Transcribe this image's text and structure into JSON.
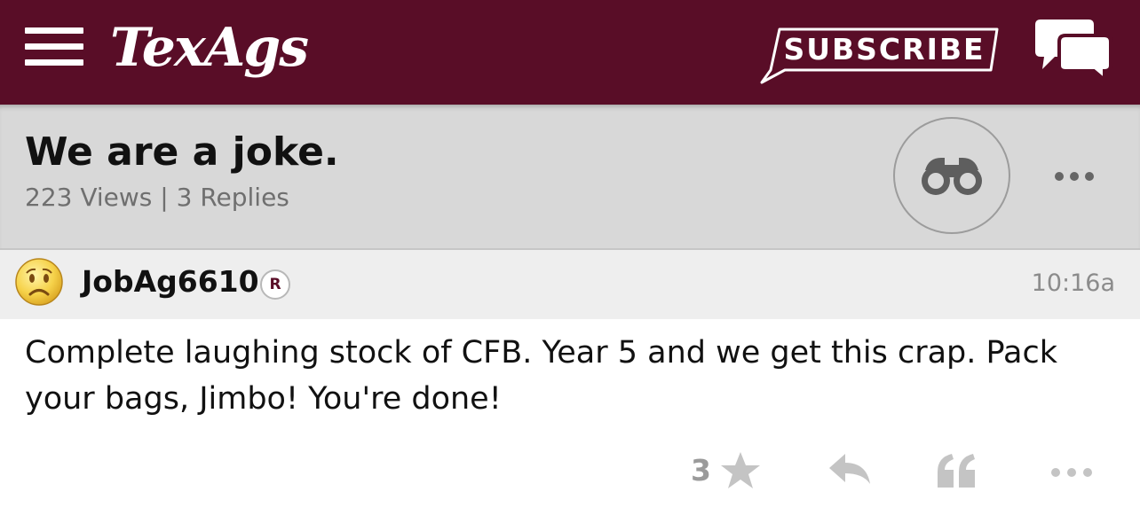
{
  "topbar": {
    "menu_icon": "hamburger-menu-icon",
    "logo_text": "TexAgs",
    "subscribe_label": "SUBSCRIBE",
    "chat_icon": "chat-bubbles-icon",
    "bg_color": "#590d27"
  },
  "thread": {
    "title": "We are a joke.",
    "meta": "223 Views | 3 Replies",
    "watch_icon": "binoculars-icon",
    "more_icon": "ellipsis-icon"
  },
  "post": {
    "avatar_icon": "frowning-face-icon",
    "username": "JobAg6610",
    "badge": "R",
    "timestamp": "10:16a",
    "body": "Complete laughing stock of CFB. Year 5 and we get this crap. Pack your bags, Jimbo! You're done!",
    "star_count": "3",
    "star_icon": "star-icon",
    "reply_icon": "reply-arrow-icon",
    "quote_icon": "quote-icon",
    "more_icon": "ellipsis-icon"
  }
}
